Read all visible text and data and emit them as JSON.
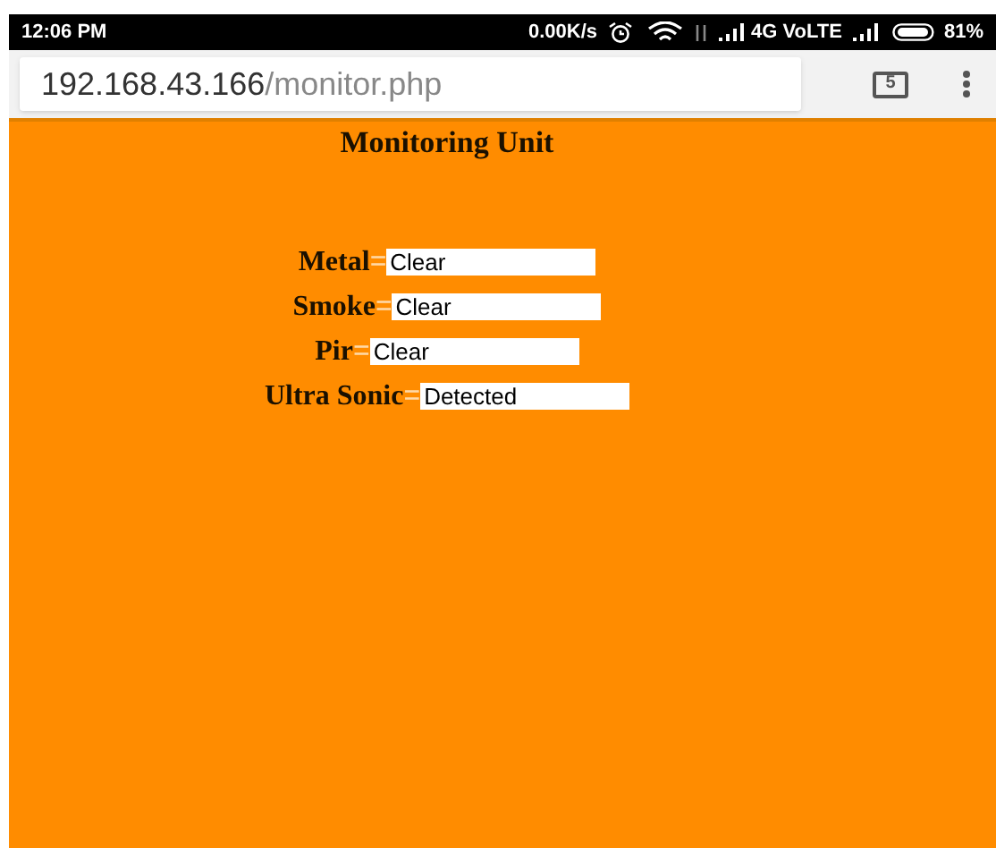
{
  "status_bar": {
    "time": "12:06 PM",
    "speed": "0.00K/s",
    "network": "4G VoLTE",
    "battery": "81%"
  },
  "address_bar": {
    "host": "192.168.43.166",
    "path": "/monitor.php",
    "tab_count": "5"
  },
  "page": {
    "title": "Monitoring Unit",
    "sensors": [
      {
        "label": "Metal",
        "equals": "=",
        "value": "Clear"
      },
      {
        "label": "Smoke",
        "equals": "=",
        "value": "Clear"
      },
      {
        "label": "Pir",
        "equals": "=",
        "value": "Clear"
      },
      {
        "label": "Ultra Sonic",
        "equals": "=",
        "value": "Detected"
      }
    ]
  }
}
